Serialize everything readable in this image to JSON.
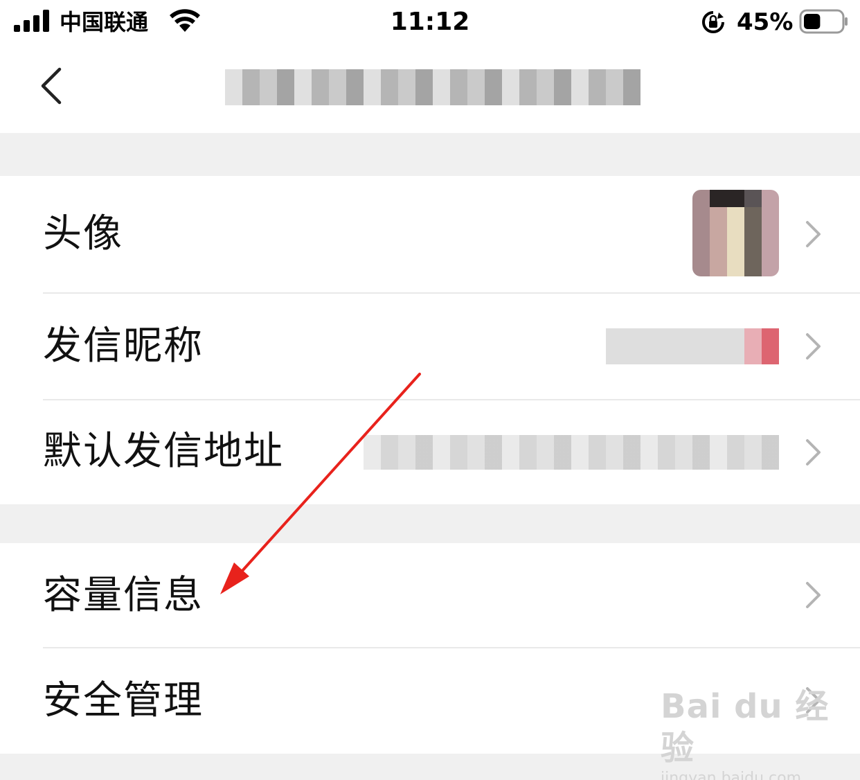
{
  "status_bar": {
    "carrier": "中国联通",
    "time": "11:12",
    "battery_percent": "45%",
    "battery_level": 0.45
  },
  "nav": {
    "back_icon": "chevron-left-icon",
    "title": ""
  },
  "settings": {
    "group1": [
      {
        "label": "头像",
        "value_type": "avatar-image"
      },
      {
        "label": "发信昵称",
        "value_type": "blurred-text"
      },
      {
        "label": "默认发信地址",
        "value_type": "blurred-text"
      }
    ],
    "group2": [
      {
        "label": "容量信息"
      },
      {
        "label": "安全管理"
      }
    ]
  },
  "watermark": {
    "brand": "Bai du 经验",
    "url": "jingyan.baidu.com"
  },
  "colors": {
    "background": "#f0f0f0",
    "row_background": "#ffffff",
    "annotation_arrow": "#e8221c",
    "chevron": "#b4b4b4"
  }
}
